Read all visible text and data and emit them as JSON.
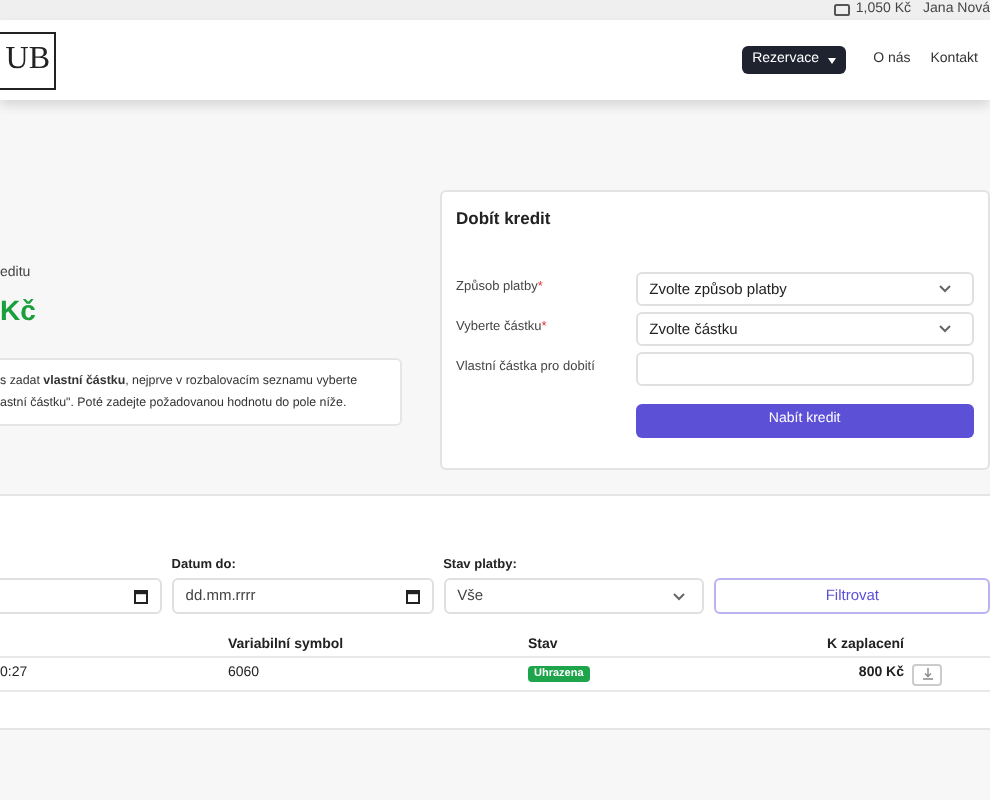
{
  "top_bar": {
    "credit": "1,050 Kč",
    "user": "Jana Nová"
  },
  "navbar": {
    "logo": "UB",
    "menu": [
      {
        "label": "Rezervace",
        "kind": "dropdown"
      },
      {
        "label": "O nás",
        "kind": "link"
      },
      {
        "label": "Kontakt",
        "kind": "link"
      }
    ]
  },
  "credit": {
    "label": "editu",
    "amount": "Kč",
    "note": "s zadat **vlastní částku**, nejprve v rozbalovacím seznamu vyberte\nastní částku\". Poté zadejte požadovanou hodnotu do pole níže."
  },
  "top_up": {
    "title": "Dobít kredit",
    "fields": [
      {
        "label": "Způsob platby",
        "required_mark": "*",
        "kind": "select",
        "value": "Zvolte způsob platby"
      },
      {
        "label": "Vyberte částku",
        "required_mark": "*",
        "kind": "select",
        "value": "Zvolte částku"
      },
      {
        "label": "Vlastní částka pro dobití",
        "kind": "input"
      }
    ],
    "button": "Nabít kredit"
  },
  "filters": {
    "fields": [
      {
        "kind": "date"
      },
      {
        "kind": "date",
        "label": "Datum do:",
        "placeholder": "dd.mm.rrrr"
      },
      {
        "kind": "select",
        "label": "Stav platby:",
        "value": "Vše"
      }
    ],
    "button": "Filtrovat"
  },
  "payments": {
    "columns": [
      "Variabilní symbol",
      "Stav",
      "K zaplacení"
    ],
    "rows": [
      {
        "time": "0:27",
        "symbol": "6060",
        "status": "Uhrazena",
        "amount": "800 Kč"
      }
    ]
  }
}
